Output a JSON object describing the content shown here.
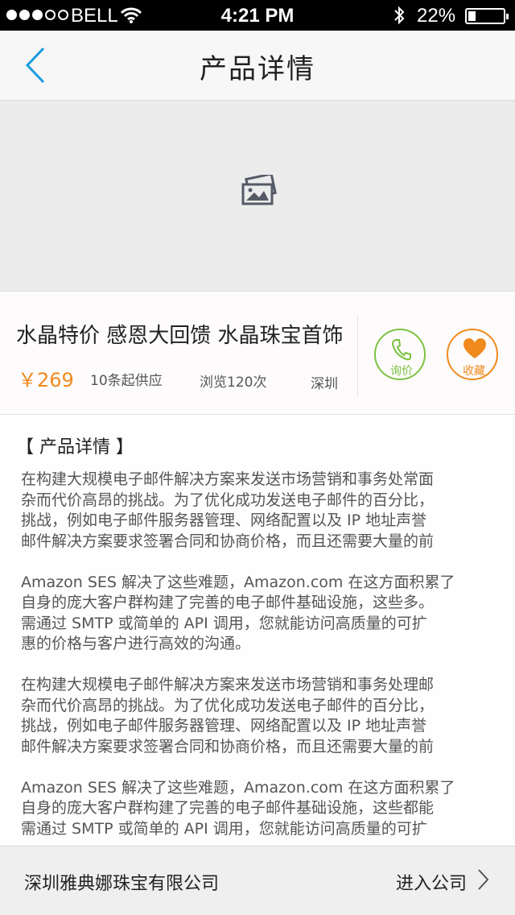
{
  "status_bar": {
    "carrier": "BELL",
    "time": "4:21 PM",
    "battery": "22%"
  },
  "nav": {
    "title": "产品详情"
  },
  "product": {
    "name": "水晶特价 感恩大回馈 水晶珠宝首饰",
    "price": "￥269",
    "moq": "10条起供应",
    "views": "浏览120次",
    "city": "深圳",
    "inquire_label": "询价",
    "collect_label": "收藏"
  },
  "detail": {
    "heading": "【 产品详情 】",
    "paragraphs": [
      [
        "在构建大规模电子邮件解决方案来发送市场营销和事务处常面",
        "杂而代价高昂的挑战。为了优化成功发送电子邮件的百分比，",
        "挑战，例如电子邮件服务器管理、网络配置以及 IP 地址声誉",
        "邮件解决方案要求签署合同和协商价格，而且还需要大量的前"
      ],
      [
        "Amazon SES 解决了这些难题，Amazon.com 在这方面积累了",
        "自身的庞大客户群构建了完善的电子邮件基础设施，这些多。",
        "需通过 SMTP 或简单的 API 调用，您就能访问高质量的可扩",
        "惠的价格与客户进行高效的沟通。"
      ],
      [
        "在构建大规模电子邮件解决方案来发送市场营销和事务处理邮",
        "杂而代价高昂的挑战。为了优化成功发送电子邮件的百分比，",
        "挑战，例如电子邮件服务器管理、网络配置以及 IP 地址声誉",
        "邮件解决方案要求签署合同和协商价格，而且还需要大量的前"
      ],
      [
        "Amazon SES 解决了这些难题，Amazon.com 在这方面积累了",
        "自身的庞大客户群构建了完善的电子邮件基础设施，这些都能",
        "需通过 SMTP 或简单的 API 调用，您就能访问高质量的可扩"
      ]
    ]
  },
  "bottom": {
    "company": "深圳雅典娜珠宝有限公司",
    "enter_label": "进入公司"
  },
  "colors": {
    "accent_blue": "#1a9be0",
    "price_orange": "#f08a1e",
    "inquire_green": "#7cc242"
  }
}
